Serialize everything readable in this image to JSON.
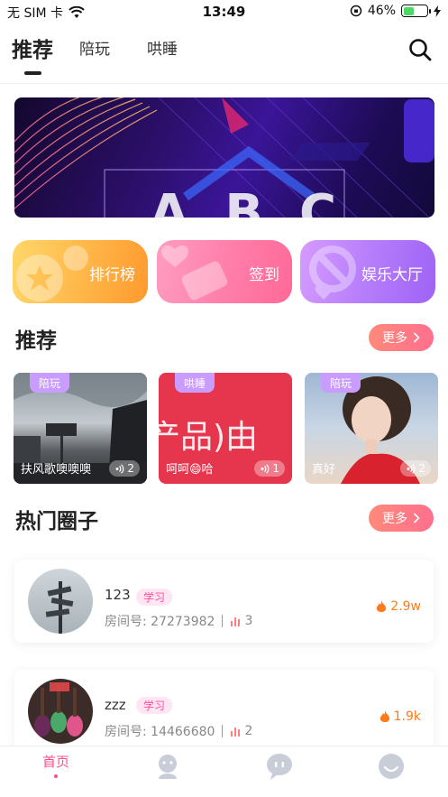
{
  "status_bar": {
    "carrier": "无 SIM 卡",
    "time": "13:49",
    "battery_pct": "46%",
    "battery_level": 0.46,
    "icons": [
      "wifi-icon",
      "orientation-lock-icon",
      "charging-icon"
    ]
  },
  "tabs": [
    {
      "label": "推荐",
      "active": true
    },
    {
      "label": "陪玩",
      "active": false
    },
    {
      "label": "哄睡",
      "active": false
    }
  ],
  "banner": {
    "letters": "ABC"
  },
  "features": [
    {
      "label": "排行榜",
      "icon": "star-medal-icon"
    },
    {
      "label": "签到",
      "icon": "ticket-icon"
    },
    {
      "label": "娱乐大厅",
      "icon": "ball-icon"
    }
  ],
  "recommend": {
    "title": "推荐",
    "more": "更多",
    "cards": [
      {
        "tag": "陪玩",
        "name": "扶风歌噢噢噢",
        "count": "2"
      },
      {
        "tag": "哄睡",
        "name": "呵呵😄哈",
        "count": "1",
        "bg_text": "产品)由"
      },
      {
        "tag": "陪玩",
        "name": "真好",
        "count": "2"
      }
    ]
  },
  "hot_circles": {
    "title": "热门圈子",
    "more": "更多",
    "items": [
      {
        "name": "123",
        "tag": "学习",
        "room_label": "房间号:",
        "room_id": "27273982",
        "members": "3",
        "hot": "2.9w"
      },
      {
        "name": "zzz",
        "tag": "学习",
        "room_label": "房间号:",
        "room_id": "14466680",
        "members": "2",
        "hot": "1.9k"
      }
    ]
  },
  "bottom_nav": {
    "home": "首页",
    "items": [
      "home",
      "companion-icon",
      "chat-icon",
      "profile-icon"
    ]
  },
  "colors": {
    "accent_pink": "#ff4f8a",
    "more_gradient_start": "#ff8a7a",
    "more_gradient_end": "#ff6f8e",
    "hot_orange": "#ff7a1a"
  }
}
